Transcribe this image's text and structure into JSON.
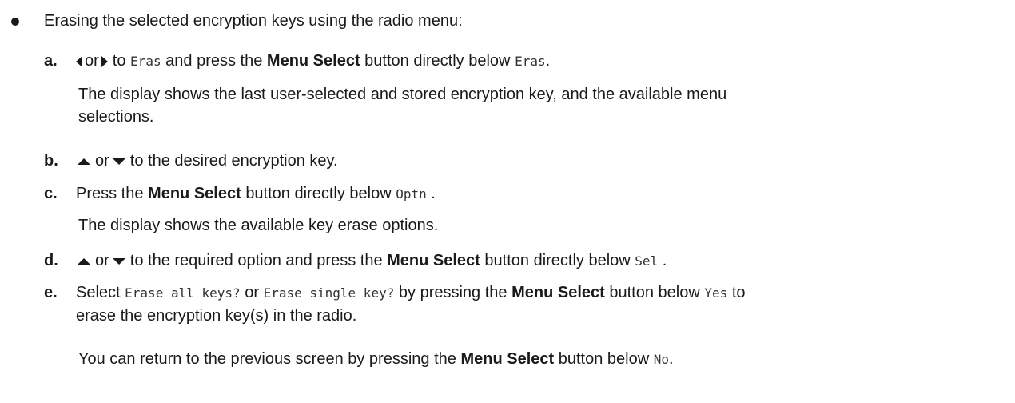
{
  "intro": "Erasing the selected encryption keys using the radio menu:",
  "steps": {
    "a": {
      "letter": "a.",
      "or": "or",
      "to": "to",
      "code1": "Eras",
      "mid": "and press the",
      "bold": "Menu Select",
      "after": "button directly below",
      "code2": "Eras",
      "end": ".",
      "result_line1": "The display shows the last user-selected and stored encryption key, and the available menu",
      "result_line2": "selections."
    },
    "b": {
      "letter": "b.",
      "or": "or",
      "rest": "to the desired encryption key."
    },
    "c": {
      "letter": "c.",
      "pre": "Press the",
      "bold": "Menu Select",
      "after": "button directly below",
      "code": "Optn",
      "end": ".",
      "result": "The display shows the available key erase options."
    },
    "d": {
      "letter": "d.",
      "or": "or",
      "mid": "to the required option and press the",
      "bold": "Menu Select",
      "after": "button directly below",
      "code": "Sel",
      "end": "."
    },
    "e": {
      "letter": "e.",
      "pre": "Select",
      "code1": "Erase all keys?",
      "or": "or",
      "code2": "Erase single key?",
      "mid": "by pressing the",
      "bold": "Menu Select",
      "after": "button below",
      "code3": "Yes",
      "end": "to",
      "line2": "erase the encryption key(s) in the radio.",
      "result_pre": "You can return to the previous screen by pressing the",
      "result_bold": "Menu Select",
      "result_after": "button below",
      "result_code": "No",
      "result_end": "."
    }
  }
}
